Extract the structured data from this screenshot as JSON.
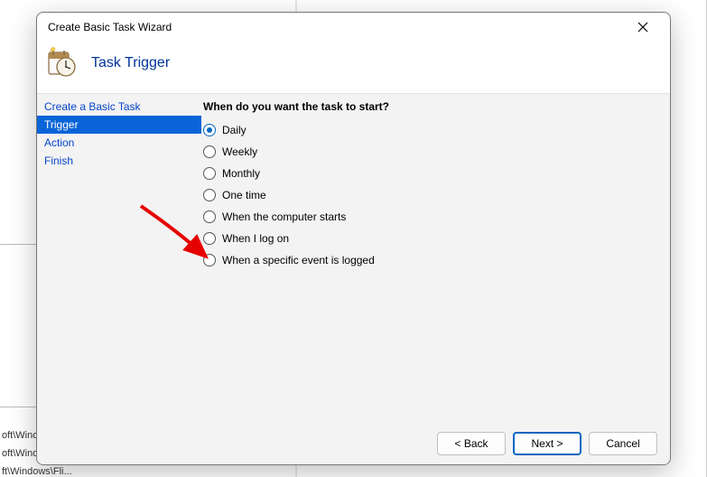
{
  "backgroundFragments": {
    "line1": "oft\\Winc",
    "line2": "oft\\Windows\\U...",
    "line3": "ft\\Windows\\Fli..."
  },
  "dialog": {
    "title": "Create Basic Task Wizard",
    "headerTitle": "Task Trigger"
  },
  "sidebar": {
    "steps": [
      {
        "label": "Create a Basic Task",
        "selected": false
      },
      {
        "label": "Trigger",
        "selected": true
      },
      {
        "label": "Action",
        "selected": false
      },
      {
        "label": "Finish",
        "selected": false
      }
    ]
  },
  "content": {
    "prompt": "When do you want the task to start?",
    "options": [
      {
        "label": "Daily",
        "checked": true
      },
      {
        "label": "Weekly",
        "checked": false
      },
      {
        "label": "Monthly",
        "checked": false
      },
      {
        "label": "One time",
        "checked": false
      },
      {
        "label": "When the computer starts",
        "checked": false
      },
      {
        "label": "When I log on",
        "checked": false
      },
      {
        "label": "When a specific event is logged",
        "checked": false
      }
    ]
  },
  "footer": {
    "back": "< Back",
    "next": "Next >",
    "cancel": "Cancel"
  }
}
